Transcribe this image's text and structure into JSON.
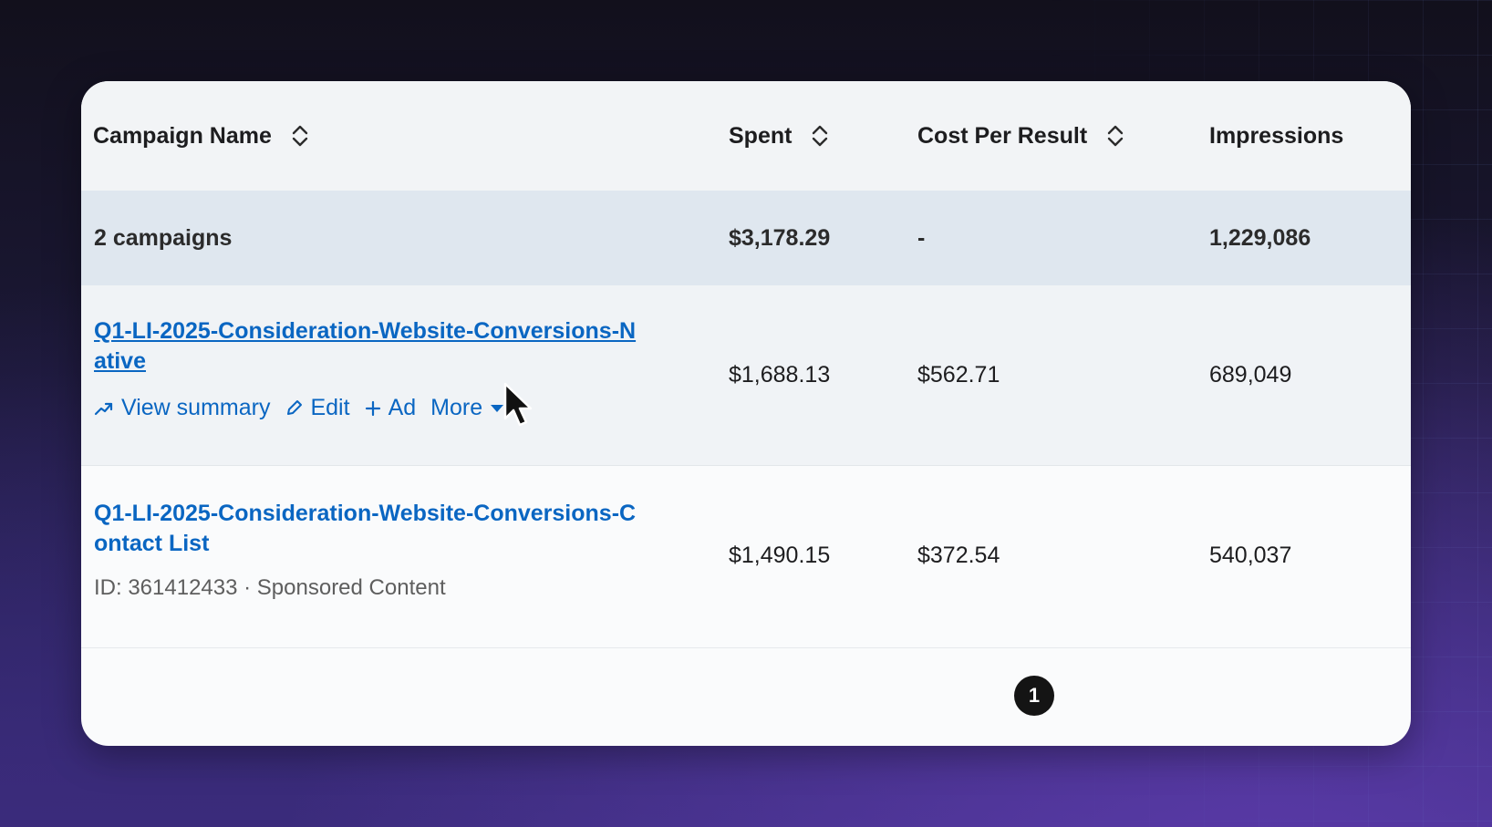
{
  "columns": {
    "campaign_name": "Campaign Name",
    "spent": "Spent",
    "cost_per_result": "Cost Per Result",
    "impressions": "Impressions"
  },
  "total": {
    "label": "2 campaigns",
    "spent": "$3,178.29",
    "cost_per_result": "-",
    "impressions": "1,229,086"
  },
  "campaigns": [
    {
      "name": "Q1-LI-2025-Consideration-Website-Conversions-Native",
      "spent": "$1,688.13",
      "cost_per_result": "$562.71",
      "impressions": "689,049",
      "actions": {
        "view_summary": "View summary",
        "edit": "Edit",
        "add_ad": "Ad",
        "more": "More"
      }
    },
    {
      "name": "Q1-LI-2025-Consideration-Website-Conversions-Contact List",
      "meta": "ID: 361412433 · Sponsored Content",
      "spent": "$1,490.15",
      "cost_per_result": "$372.54",
      "impressions": "540,037"
    }
  ],
  "pagination": {
    "current_page": "1"
  },
  "colors": {
    "link": "#0a66c2",
    "header_bg": "#f2f4f6",
    "total_row_bg": "#dfe7ef",
    "pager_bg": "#141414"
  },
  "icons": [
    "sort-icon",
    "trend-up-icon",
    "pencil-icon",
    "plus-icon",
    "caret-down-icon",
    "mouse-pointer-icon"
  ]
}
